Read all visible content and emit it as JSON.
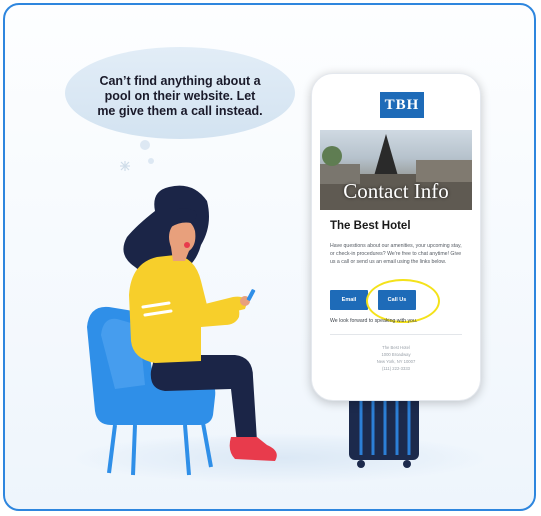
{
  "bubble": {
    "text": "Can’t find anything about a pool on their website. Let me give them a call instead."
  },
  "phone": {
    "logo": "TBH",
    "hero_title": "Contact Info",
    "hotel_name": "The Best Hotel",
    "paragraph": "Have questions about our amenities, your upcoming stay, or check-in procedures? We’re free to chat anytime! Give us a call or send us an email using the links below.",
    "email_button": "Email",
    "call_button": "Call Us",
    "closing": "We look forward to speaking with you.",
    "footer_lines": [
      "The Best Hotel",
      "1000 Broadway",
      "New York, NY 10007",
      "(111) 222-3333"
    ]
  },
  "colors": {
    "accent": "#1e6bb8",
    "frame_border": "#2e86de",
    "highlight": "#f4e21a",
    "sweater": "#f7cf2b",
    "chair": "#2f8fe8",
    "shoes": "#e83b4c",
    "luggage": "#1c2a4c"
  },
  "icons": [
    "sparkle-icon"
  ]
}
